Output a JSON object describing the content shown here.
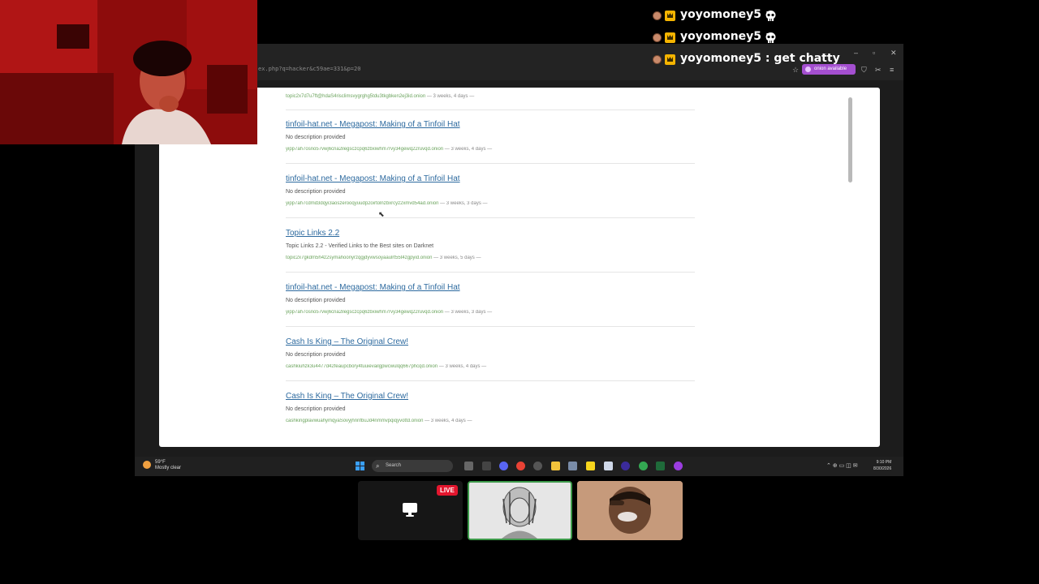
{
  "browser": {
    "url": "ex.php?q=hacker&c59ae=331&p=20",
    "onion_badge": "onion available"
  },
  "top_result_url": "topic2x7d7u7ft@hdaS4risclimsvygrghg5tdu3tkgbken2ej3id.onion",
  "top_result_age": " — 3 weeks, 4 days —",
  "results": [
    {
      "title": "tinfoil-hat.net - Megapost: Making of a Tinfoil Hat",
      "description": "No description provided",
      "url": "yipp7ah7osno57vwj6cna2ilegsczcpq6zbxiwhm7rvy34gewq22ruvqd.onion",
      "age": " — 3 weeks, 4 days —"
    },
    {
      "title": "tinfoil-hat.net - Megapost: Making of a Tinfoil Hat",
      "description": "No description provided",
      "url": "yipp7ah7cdmd3dqyi3aoszerooqyuudp2oirtolnzbxrcyz2xmvd54ad.onion",
      "age": " — 3 weeks, 3 days —"
    },
    {
      "title": "Topic Links 2.2",
      "description": "Topic Links 2.2 - Verified Links to the Best sites on Darknet",
      "url": "topic2x7gkdm5h4z2symahoonyrzqgjdyvwsoyaaulrt55t4zgpyid.onion",
      "age": " — 3 weeks, 5 days —"
    },
    {
      "title": "tinfoil-hat.net - Megapost: Making of a Tinfoil Hat",
      "description": "No description provided",
      "url": "yipp7ah7osno57vwj6cna2ilegsczcpq6zbxiwhm7rvy34gewq22ruvqd.onion",
      "age": " — 3 weeks, 3 days —"
    },
    {
      "title": "Cash Is King – The Original Crew!",
      "description": "No description provided",
      "url": "cashkiuhzk3u4477d42feaupcbory4tuuievailgpwcwulqq667phcqd.onion",
      "age": " — 3 weeks, 4 days —"
    },
    {
      "title": "Cash Is King – The Original Crew!",
      "description": "No description provided",
      "url": "cashkingplavwuahymqyaSovyjhnnfbuJd4nmmvpqiqyvottd.onion",
      "age": " — 3 weeks, 4 days —"
    }
  ],
  "taskbar": {
    "weather_temp": "59°F",
    "weather_desc": "Mostly clear",
    "search_label": "Search",
    "time": "9:10 PM",
    "date": "8/30/2026"
  },
  "chat": [
    {
      "user": "yoyomoney5",
      "sep": " :",
      "message": "",
      "emote": "skull-emote"
    },
    {
      "user": "yoyomoney5",
      "sep": " :",
      "message": "",
      "emote": "skull-emote"
    },
    {
      "user": "yoyomoney5",
      "sep": " :",
      "message": " get chatty",
      "emote": ""
    }
  ],
  "stream": {
    "live_label": "LIVE"
  },
  "colors": {
    "link": "#2d6a9f",
    "url_green": "#6aa35c",
    "live_red": "#e3162e",
    "onion_purple": "#a44fd0",
    "speaker_border": "#3d9a4a"
  }
}
